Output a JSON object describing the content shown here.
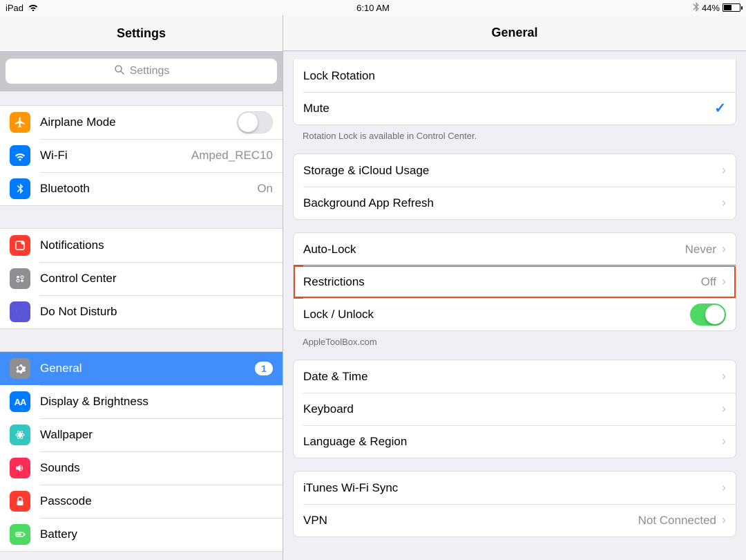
{
  "statusbar": {
    "device": "iPad",
    "time": "6:10 AM",
    "battery_pct": "44%"
  },
  "sidebar": {
    "title": "Settings",
    "search_placeholder": "Settings",
    "groups": [
      [
        {
          "id": "airplane",
          "label": "Airplane Mode",
          "icon_bg": "#ff9500",
          "icon": "plane",
          "control": "toggle",
          "toggle_on": false
        },
        {
          "id": "wifi",
          "label": "Wi-Fi",
          "icon_bg": "#007aff",
          "icon": "wifi",
          "value": "Amped_REC10"
        },
        {
          "id": "bluetooth",
          "label": "Bluetooth",
          "icon_bg": "#007aff",
          "icon": "bt",
          "value": "On"
        }
      ],
      [
        {
          "id": "notifications",
          "label": "Notifications",
          "icon_bg": "#ff3b30",
          "icon": "notif"
        },
        {
          "id": "control-center",
          "label": "Control Center",
          "icon_bg": "#8e8e93",
          "icon": "cc"
        },
        {
          "id": "dnd",
          "label": "Do Not Disturb",
          "icon_bg": "#5856d6",
          "icon": "moon"
        }
      ],
      [
        {
          "id": "general",
          "label": "General",
          "icon_bg": "#8e8e93",
          "icon": "gear",
          "badge": "1",
          "selected": true
        },
        {
          "id": "display",
          "label": "Display & Brightness",
          "icon_bg": "#007aff",
          "icon": "aa"
        },
        {
          "id": "wallpaper",
          "label": "Wallpaper",
          "icon_bg": "#2ac7c7",
          "icon": "flower"
        },
        {
          "id": "sounds",
          "label": "Sounds",
          "icon_bg": "#ff2d55",
          "icon": "speaker"
        },
        {
          "id": "passcode",
          "label": "Passcode",
          "icon_bg": "#ff3b30",
          "icon": "lock"
        },
        {
          "id": "battery",
          "label": "Battery",
          "icon_bg": "#4cd964",
          "icon": "battery"
        }
      ]
    ]
  },
  "detail": {
    "title": "General",
    "group0": {
      "lock_rotation": "Lock Rotation",
      "mute": "Mute",
      "note": "Rotation Lock is available in Control Center."
    },
    "group1": {
      "storage": "Storage & iCloud Usage",
      "bg_refresh": "Background App Refresh"
    },
    "group2": {
      "auto_lock": "Auto-Lock",
      "auto_lock_val": "Never",
      "restrictions": "Restrictions",
      "restrictions_val": "Off",
      "lock_unlock": "Lock / Unlock",
      "watermark": "AppleToolBox.com"
    },
    "group3": {
      "date_time": "Date & Time",
      "keyboard": "Keyboard",
      "lang_region": "Language & Region"
    },
    "group4": {
      "itunes_wifi": "iTunes Wi-Fi Sync",
      "vpn": "VPN",
      "vpn_val": "Not Connected"
    }
  }
}
